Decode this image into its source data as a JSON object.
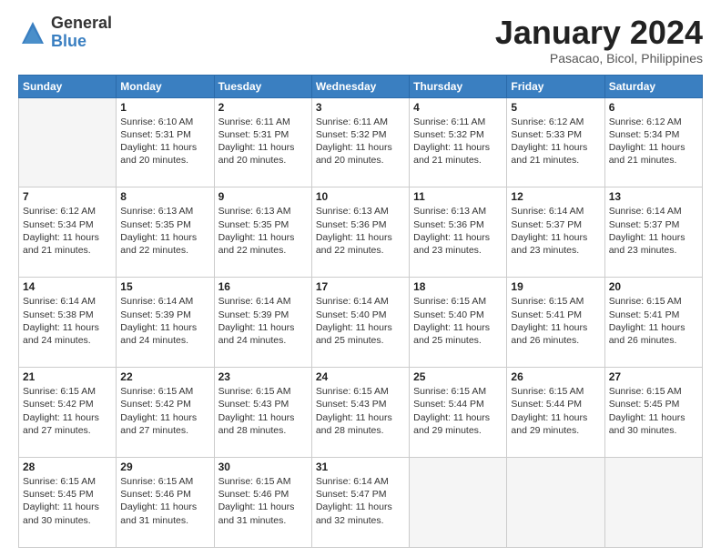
{
  "logo": {
    "general": "General",
    "blue": "Blue"
  },
  "title": "January 2024",
  "location": "Pasacao, Bicol, Philippines",
  "days_of_week": [
    "Sunday",
    "Monday",
    "Tuesday",
    "Wednesday",
    "Thursday",
    "Friday",
    "Saturday"
  ],
  "weeks": [
    [
      {
        "day": "",
        "sunrise": "",
        "sunset": "",
        "daylight": ""
      },
      {
        "day": "1",
        "sunrise": "Sunrise: 6:10 AM",
        "sunset": "Sunset: 5:31 PM",
        "daylight": "Daylight: 11 hours and 20 minutes."
      },
      {
        "day": "2",
        "sunrise": "Sunrise: 6:11 AM",
        "sunset": "Sunset: 5:31 PM",
        "daylight": "Daylight: 11 hours and 20 minutes."
      },
      {
        "day": "3",
        "sunrise": "Sunrise: 6:11 AM",
        "sunset": "Sunset: 5:32 PM",
        "daylight": "Daylight: 11 hours and 20 minutes."
      },
      {
        "day": "4",
        "sunrise": "Sunrise: 6:11 AM",
        "sunset": "Sunset: 5:32 PM",
        "daylight": "Daylight: 11 hours and 21 minutes."
      },
      {
        "day": "5",
        "sunrise": "Sunrise: 6:12 AM",
        "sunset": "Sunset: 5:33 PM",
        "daylight": "Daylight: 11 hours and 21 minutes."
      },
      {
        "day": "6",
        "sunrise": "Sunrise: 6:12 AM",
        "sunset": "Sunset: 5:34 PM",
        "daylight": "Daylight: 11 hours and 21 minutes."
      }
    ],
    [
      {
        "day": "7",
        "sunrise": "Sunrise: 6:12 AM",
        "sunset": "Sunset: 5:34 PM",
        "daylight": "Daylight: 11 hours and 21 minutes."
      },
      {
        "day": "8",
        "sunrise": "Sunrise: 6:13 AM",
        "sunset": "Sunset: 5:35 PM",
        "daylight": "Daylight: 11 hours and 22 minutes."
      },
      {
        "day": "9",
        "sunrise": "Sunrise: 6:13 AM",
        "sunset": "Sunset: 5:35 PM",
        "daylight": "Daylight: 11 hours and 22 minutes."
      },
      {
        "day": "10",
        "sunrise": "Sunrise: 6:13 AM",
        "sunset": "Sunset: 5:36 PM",
        "daylight": "Daylight: 11 hours and 22 minutes."
      },
      {
        "day": "11",
        "sunrise": "Sunrise: 6:13 AM",
        "sunset": "Sunset: 5:36 PM",
        "daylight": "Daylight: 11 hours and 23 minutes."
      },
      {
        "day": "12",
        "sunrise": "Sunrise: 6:14 AM",
        "sunset": "Sunset: 5:37 PM",
        "daylight": "Daylight: 11 hours and 23 minutes."
      },
      {
        "day": "13",
        "sunrise": "Sunrise: 6:14 AM",
        "sunset": "Sunset: 5:37 PM",
        "daylight": "Daylight: 11 hours and 23 minutes."
      }
    ],
    [
      {
        "day": "14",
        "sunrise": "Sunrise: 6:14 AM",
        "sunset": "Sunset: 5:38 PM",
        "daylight": "Daylight: 11 hours and 24 minutes."
      },
      {
        "day": "15",
        "sunrise": "Sunrise: 6:14 AM",
        "sunset": "Sunset: 5:39 PM",
        "daylight": "Daylight: 11 hours and 24 minutes."
      },
      {
        "day": "16",
        "sunrise": "Sunrise: 6:14 AM",
        "sunset": "Sunset: 5:39 PM",
        "daylight": "Daylight: 11 hours and 24 minutes."
      },
      {
        "day": "17",
        "sunrise": "Sunrise: 6:14 AM",
        "sunset": "Sunset: 5:40 PM",
        "daylight": "Daylight: 11 hours and 25 minutes."
      },
      {
        "day": "18",
        "sunrise": "Sunrise: 6:15 AM",
        "sunset": "Sunset: 5:40 PM",
        "daylight": "Daylight: 11 hours and 25 minutes."
      },
      {
        "day": "19",
        "sunrise": "Sunrise: 6:15 AM",
        "sunset": "Sunset: 5:41 PM",
        "daylight": "Daylight: 11 hours and 26 minutes."
      },
      {
        "day": "20",
        "sunrise": "Sunrise: 6:15 AM",
        "sunset": "Sunset: 5:41 PM",
        "daylight": "Daylight: 11 hours and 26 minutes."
      }
    ],
    [
      {
        "day": "21",
        "sunrise": "Sunrise: 6:15 AM",
        "sunset": "Sunset: 5:42 PM",
        "daylight": "Daylight: 11 hours and 27 minutes."
      },
      {
        "day": "22",
        "sunrise": "Sunrise: 6:15 AM",
        "sunset": "Sunset: 5:42 PM",
        "daylight": "Daylight: 11 hours and 27 minutes."
      },
      {
        "day": "23",
        "sunrise": "Sunrise: 6:15 AM",
        "sunset": "Sunset: 5:43 PM",
        "daylight": "Daylight: 11 hours and 28 minutes."
      },
      {
        "day": "24",
        "sunrise": "Sunrise: 6:15 AM",
        "sunset": "Sunset: 5:43 PM",
        "daylight": "Daylight: 11 hours and 28 minutes."
      },
      {
        "day": "25",
        "sunrise": "Sunrise: 6:15 AM",
        "sunset": "Sunset: 5:44 PM",
        "daylight": "Daylight: 11 hours and 29 minutes."
      },
      {
        "day": "26",
        "sunrise": "Sunrise: 6:15 AM",
        "sunset": "Sunset: 5:44 PM",
        "daylight": "Daylight: 11 hours and 29 minutes."
      },
      {
        "day": "27",
        "sunrise": "Sunrise: 6:15 AM",
        "sunset": "Sunset: 5:45 PM",
        "daylight": "Daylight: 11 hours and 30 minutes."
      }
    ],
    [
      {
        "day": "28",
        "sunrise": "Sunrise: 6:15 AM",
        "sunset": "Sunset: 5:45 PM",
        "daylight": "Daylight: 11 hours and 30 minutes."
      },
      {
        "day": "29",
        "sunrise": "Sunrise: 6:15 AM",
        "sunset": "Sunset: 5:46 PM",
        "daylight": "Daylight: 11 hours and 31 minutes."
      },
      {
        "day": "30",
        "sunrise": "Sunrise: 6:15 AM",
        "sunset": "Sunset: 5:46 PM",
        "daylight": "Daylight: 11 hours and 31 minutes."
      },
      {
        "day": "31",
        "sunrise": "Sunrise: 6:14 AM",
        "sunset": "Sunset: 5:47 PM",
        "daylight": "Daylight: 11 hours and 32 minutes."
      },
      {
        "day": "",
        "sunrise": "",
        "sunset": "",
        "daylight": ""
      },
      {
        "day": "",
        "sunrise": "",
        "sunset": "",
        "daylight": ""
      },
      {
        "day": "",
        "sunrise": "",
        "sunset": "",
        "daylight": ""
      }
    ]
  ]
}
